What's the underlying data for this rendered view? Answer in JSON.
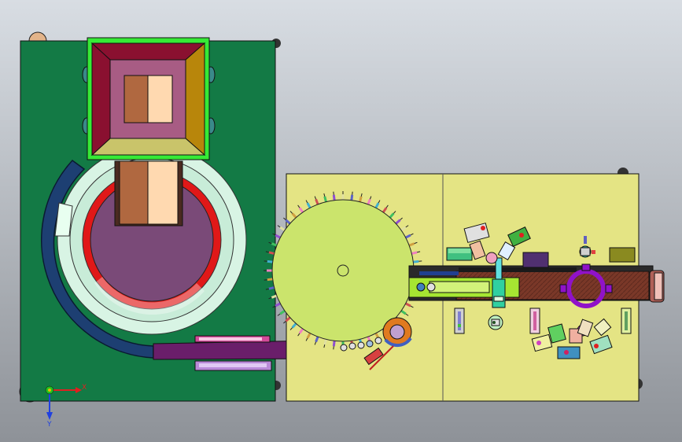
{
  "viewport": {
    "background_top": "#d8dde3",
    "background_bottom": "#8e9298"
  },
  "colors": {
    "left_plate": "#137a45",
    "right_plate": "#e4e484",
    "hopper_frame": "#36ea36",
    "hopper_dark": "#8a1030",
    "hopper_pink": "#a85c84",
    "hopper_gold": "#b8860b",
    "hopper_tan": "#c9c46a",
    "chute_brown": "#b06840",
    "chute_light": "#ffd9b0",
    "bowl_outer": "#1d3f72",
    "bowl_mint": "#d8f4e4",
    "bowl_red": "#e01818",
    "bowl_purple": "#7a4a78",
    "track_purple": "#6a1e6a",
    "dial_green": "#cbe46c",
    "conveyor_brown": "#7a3828",
    "ring_purple": "#9012c8",
    "line_green": "#a6e632"
  },
  "triad": {
    "x_label": "X",
    "y_label": "Y",
    "x_color": "#e02020",
    "y_color": "#20c020",
    "z_color": "#2040e0",
    "origin_color": "#e0c000"
  },
  "icons": {
    "triad": "coordinate-axes-icon"
  }
}
